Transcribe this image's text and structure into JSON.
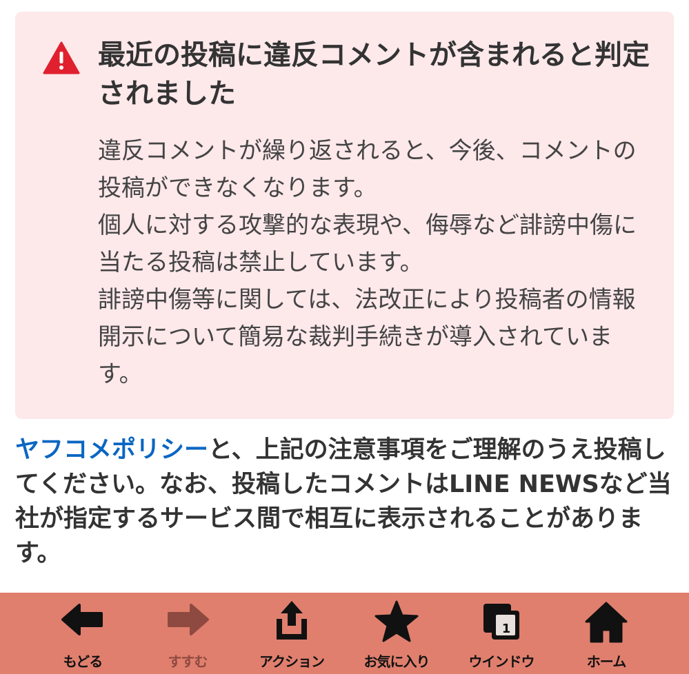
{
  "warning": {
    "title": "最近の投稿に違反コメントが含まれると判定されました",
    "paragraphs": [
      "違反コメントが繰り返されると、今後、コメントの投稿ができなくなります。",
      "個人に対する攻撃的な表現や、侮辱など誹謗中傷に当たる投稿は禁止しています。",
      "誹謗中傷等に関しては、法改正により投稿者の情報開示について簡易な裁判手続きが導入されています。"
    ],
    "icon": "warning-triangle-icon",
    "accent_color": "#e0202e",
    "background_color": "#fde8ea"
  },
  "notice": {
    "link_text": "ヤフコメポリシー",
    "text": "と、上記の注意事項をご理解のうえ投稿してください。なお、投稿したコメントはLINE NEWSなど当社が指定するサービス間で相互に表示されることがあります。",
    "link_color": "#0a66c2"
  },
  "toolbar": {
    "background_color": "#e07f6e",
    "back_label": "もどる",
    "forward_label": "すすむ",
    "action_label": "アクション",
    "favorites_label": "お気に入り",
    "window_label": "ウインドウ",
    "window_count": "1",
    "home_label": "ホーム"
  }
}
